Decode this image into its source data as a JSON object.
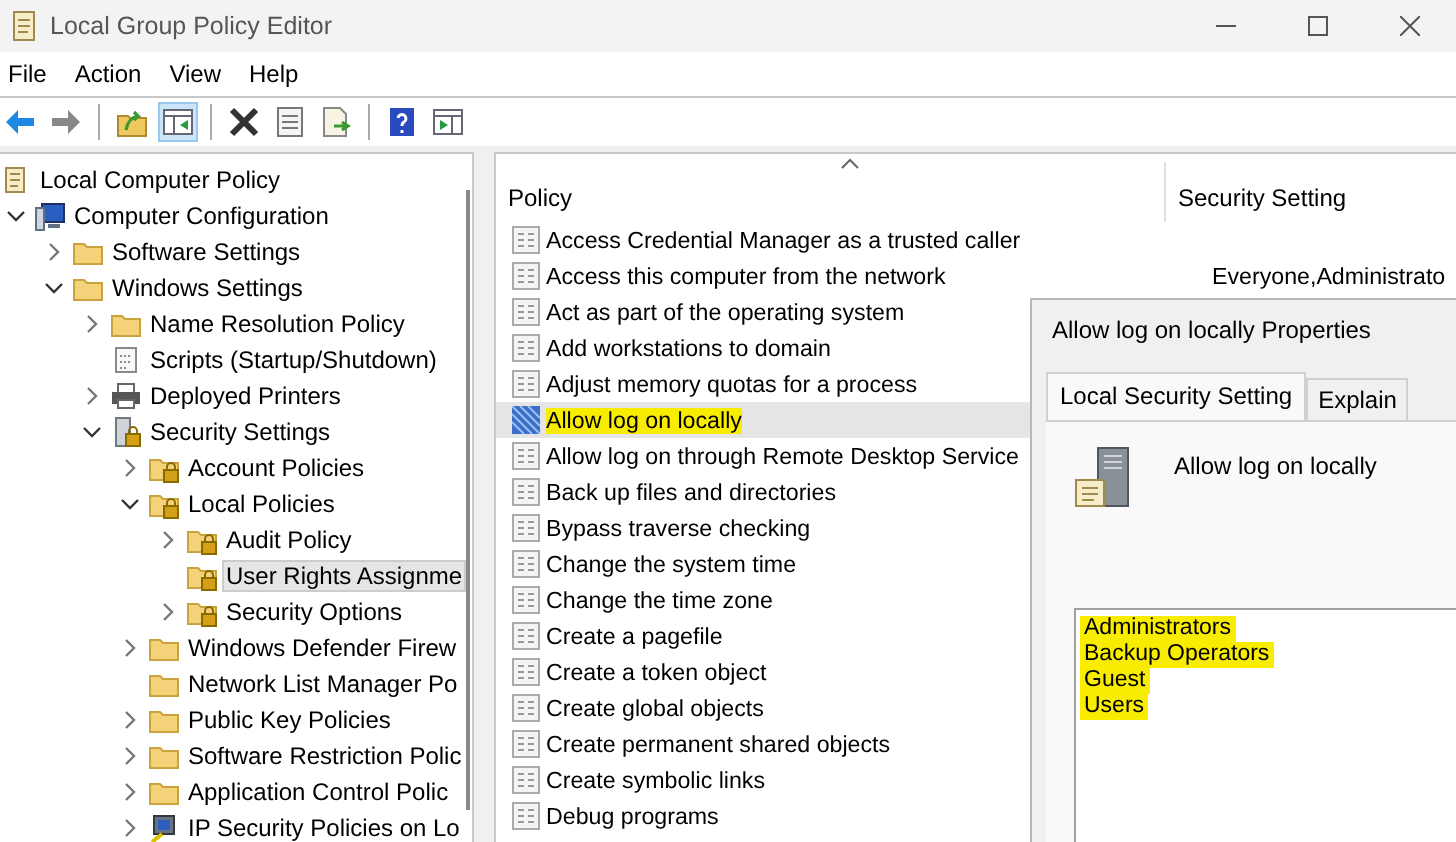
{
  "window": {
    "title": "Local Group Policy Editor"
  },
  "menu": [
    "File",
    "Action",
    "View",
    "Help"
  ],
  "toolbar": [
    [
      {
        "kind": "back",
        "pressed": false
      },
      {
        "kind": "forward",
        "pressed": false
      }
    ],
    [
      {
        "kind": "up",
        "pressed": false
      },
      {
        "kind": "tree-toggle",
        "pressed": true
      }
    ],
    [
      {
        "kind": "delete",
        "pressed": false
      },
      {
        "kind": "properties",
        "pressed": false
      },
      {
        "kind": "export",
        "pressed": false
      }
    ],
    [
      {
        "kind": "help",
        "pressed": false
      },
      {
        "kind": "action-pane",
        "pressed": false
      }
    ]
  ],
  "tree": [
    {
      "label": "Local Computer Policy",
      "kind": "doc",
      "selected": false,
      "highlighted": false,
      "children": [
        {
          "label": "Computer Configuration",
          "kind": "computer",
          "expanded": true,
          "selected": false,
          "highlighted": false,
          "children": [
            {
              "label": "Software Settings",
              "kind": "folder",
              "expanded": false,
              "selected": false,
              "highlighted": false
            },
            {
              "label": "Windows Settings",
              "kind": "folder",
              "expanded": true,
              "selected": false,
              "highlighted": false,
              "children": [
                {
                  "label": "Name Resolution Policy",
                  "kind": "folder",
                  "expanded": false,
                  "selected": false,
                  "highlighted": false
                },
                {
                  "label": "Scripts (Startup/Shutdown)",
                  "kind": "script",
                  "selected": false,
                  "highlighted": false
                },
                {
                  "label": "Deployed Printers",
                  "kind": "printer",
                  "expanded": false,
                  "selected": false,
                  "highlighted": false
                },
                {
                  "label": "Security Settings",
                  "kind": "security",
                  "expanded": true,
                  "selected": false,
                  "highlighted": false,
                  "children": [
                    {
                      "label": "Account Policies",
                      "kind": "locked-folder",
                      "expanded": false,
                      "selected": false,
                      "highlighted": false
                    },
                    {
                      "label": "Local Policies",
                      "kind": "locked-folder",
                      "expanded": true,
                      "selected": false,
                      "highlighted": false,
                      "children": [
                        {
                          "label": "Audit Policy",
                          "kind": "locked-folder",
                          "expanded": false,
                          "selected": false,
                          "highlighted": false
                        },
                        {
                          "label": "User Rights Assignme",
                          "kind": "locked-folder",
                          "selected": true,
                          "highlighted": true
                        },
                        {
                          "label": "Security Options",
                          "kind": "locked-folder",
                          "expanded": false,
                          "selected": false,
                          "highlighted": false
                        }
                      ]
                    },
                    {
                      "label": "Windows Defender Firew",
                      "kind": "folder",
                      "expanded": false,
                      "selected": false,
                      "highlighted": false
                    },
                    {
                      "label": "Network List Manager Po",
                      "kind": "folder",
                      "selected": false,
                      "highlighted": false
                    },
                    {
                      "label": "Public Key Policies",
                      "kind": "folder",
                      "expanded": false,
                      "selected": false,
                      "highlighted": false
                    },
                    {
                      "label": "Software Restriction Polic",
                      "kind": "folder",
                      "expanded": false,
                      "selected": false,
                      "highlighted": false
                    },
                    {
                      "label": "Application Control Polic",
                      "kind": "folder",
                      "expanded": false,
                      "selected": false,
                      "highlighted": false
                    },
                    {
                      "label": "IP Security Policies on Lo",
                      "kind": "ip-security",
                      "expanded": false,
                      "selected": false,
                      "highlighted": false
                    }
                  ]
                }
              ]
            }
          ]
        }
      ]
    }
  ],
  "table": {
    "columns": [
      "Policy",
      "Security Setting"
    ],
    "rows": [
      {
        "policy": "Access Credential Manager as a trusted caller",
        "selected": false,
        "highlighted": false
      },
      {
        "policy": "Access this computer from the network",
        "setting": "Everyone,Administrato",
        "selected": false,
        "highlighted": false
      },
      {
        "policy": "Act as part of the operating system",
        "selected": false,
        "highlighted": false
      },
      {
        "policy": "Add workstations to domain",
        "selected": false,
        "highlighted": false
      },
      {
        "policy": "Adjust memory quotas for a process",
        "selected": false,
        "highlighted": false
      },
      {
        "policy": "Allow log on locally",
        "selected": true,
        "highlighted": true
      },
      {
        "policy": "Allow log on through Remote Desktop Service",
        "selected": false,
        "highlighted": false
      },
      {
        "policy": "Back up files and directories",
        "selected": false,
        "highlighted": false
      },
      {
        "policy": "Bypass traverse checking",
        "selected": false,
        "highlighted": false
      },
      {
        "policy": "Change the system time",
        "selected": false,
        "highlighted": false
      },
      {
        "policy": "Change the time zone",
        "selected": false,
        "highlighted": false
      },
      {
        "policy": "Create a pagefile",
        "selected": false,
        "highlighted": false
      },
      {
        "policy": "Create a token object",
        "selected": false,
        "highlighted": false
      },
      {
        "policy": "Create global objects",
        "selected": false,
        "highlighted": false
      },
      {
        "policy": "Create permanent shared objects",
        "selected": false,
        "highlighted": false
      },
      {
        "policy": "Create symbolic links",
        "selected": false,
        "highlighted": false
      },
      {
        "policy": "Debug programs",
        "selected": false,
        "highlighted": false
      }
    ]
  },
  "dialog": {
    "title": "Allow log on locally Properties",
    "tabs": [
      {
        "label": "Local Security Setting",
        "selected": true
      },
      {
        "label": "Explain",
        "selected": false
      }
    ],
    "policy_name": "Allow log on locally",
    "members": [
      {
        "name": "Administrators",
        "highlighted": true
      },
      {
        "name": "Backup Operators",
        "highlighted": true
      },
      {
        "name": "Guest",
        "highlighted": true
      },
      {
        "name": "Users",
        "highlighted": true
      }
    ]
  }
}
